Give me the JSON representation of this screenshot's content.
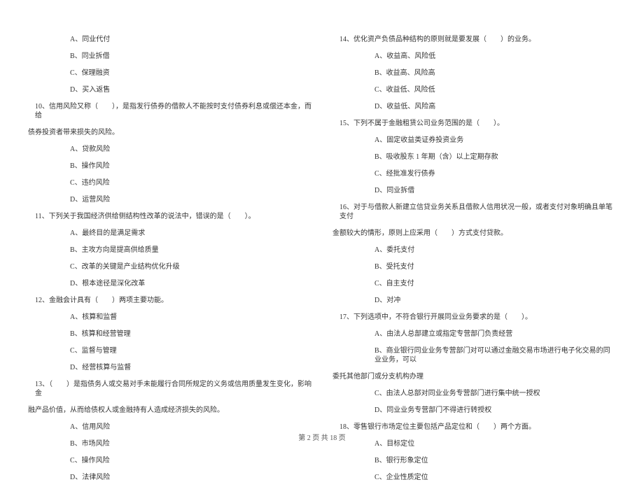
{
  "left_column": {
    "items": [
      {
        "type": "option",
        "text": "A、同业代付"
      },
      {
        "type": "option",
        "text": "B、同业拆借"
      },
      {
        "type": "option",
        "text": "C、保理融资"
      },
      {
        "type": "option",
        "text": "D、买入返售"
      },
      {
        "type": "question",
        "text": "10、信用风险又称（　　），是指发行债券的借款人不能按时支付债券利息或偿还本金，而给"
      },
      {
        "type": "question_cont",
        "text": "债券投资者带来损失的风险。"
      },
      {
        "type": "option",
        "text": "A、贷款风险"
      },
      {
        "type": "option",
        "text": "B、操作风险"
      },
      {
        "type": "option",
        "text": "C、违约风险"
      },
      {
        "type": "option",
        "text": "D、运营风险"
      },
      {
        "type": "question",
        "text": "11、下列关于我国经济供给侧结构性改革的说法中，错误的是（　　）。"
      },
      {
        "type": "option",
        "text": "A、最终目的是满足需求"
      },
      {
        "type": "option",
        "text": "B、主攻方向是提高供给质量"
      },
      {
        "type": "option",
        "text": "C、改革的关键是产业结构优化升级"
      },
      {
        "type": "option",
        "text": "D、根本途径是深化改革"
      },
      {
        "type": "question",
        "text": "12、金融会计具有（　　）两项主要功能。"
      },
      {
        "type": "option",
        "text": "A、核算和监督"
      },
      {
        "type": "option",
        "text": "B、核算和经营管理"
      },
      {
        "type": "option",
        "text": "C、监督与管理"
      },
      {
        "type": "option",
        "text": "D、经营核算与监督"
      },
      {
        "type": "question",
        "text": "13、（　　）是指债务人或交易对手未能履行合同所规定的义务或信用质量发生变化，影响金"
      },
      {
        "type": "question_cont",
        "text": "融产品价值，从而给债权人或金融持有人造成经济损失的风险。"
      },
      {
        "type": "option",
        "text": "A、信用风险"
      },
      {
        "type": "option",
        "text": "B、市场风险"
      },
      {
        "type": "option",
        "text": "C、操作风险"
      },
      {
        "type": "option",
        "text": "D、法律风险"
      }
    ]
  },
  "right_column": {
    "items": [
      {
        "type": "question",
        "text": "14、优化资产负债品种结构的原则就是要发展（　　）的业务。"
      },
      {
        "type": "option",
        "text": "A、收益高、风险低"
      },
      {
        "type": "option",
        "text": "B、收益高、风险高"
      },
      {
        "type": "option",
        "text": "C、收益低、风险低"
      },
      {
        "type": "option",
        "text": "D、收益低、风险高"
      },
      {
        "type": "question",
        "text": "15、下列不属于金融租赁公司业务范围的是（　　）。"
      },
      {
        "type": "option",
        "text": "A、固定收益类证券投资业务"
      },
      {
        "type": "option",
        "text": "B、吸收股东 1 年期（含）以上定期存款"
      },
      {
        "type": "option",
        "text": "C、经批准发行债券"
      },
      {
        "type": "option",
        "text": "D、同业拆借"
      },
      {
        "type": "question",
        "text": "16、对于与借款人新建立信贷业务关系且借款人信用状况一般，或者支付对象明确且单笔支付"
      },
      {
        "type": "question_cont",
        "text": "金额较大的情形，原则上应采用（　　）方式支付贷款。"
      },
      {
        "type": "option",
        "text": "A、委托支付"
      },
      {
        "type": "option",
        "text": "B、受托支付"
      },
      {
        "type": "option",
        "text": "C、自主支付"
      },
      {
        "type": "option",
        "text": "D、对冲"
      },
      {
        "type": "question",
        "text": "17、下列选项中，不符合银行开展同业业务要求的是（　　）。"
      },
      {
        "type": "option",
        "text": "A、由法人总部建立或指定专营部门负责经营"
      },
      {
        "type": "option",
        "text": "B、商业银行同业业务专营部门对可以通过金融交易市场进行电子化交易的同业业务，可以"
      },
      {
        "type": "question_cont",
        "text": "委托其他部门或分支机构办理"
      },
      {
        "type": "option",
        "text": "C、由法人总部对同业业务专营部门进行集中统一授权"
      },
      {
        "type": "option",
        "text": "D、同业业务专营部门不得进行转授权"
      },
      {
        "type": "question",
        "text": "18、零售银行市场定位主要包括产品定位和（　　）两个方面。"
      },
      {
        "type": "option",
        "text": "A、目标定位"
      },
      {
        "type": "option",
        "text": "B、银行形象定位"
      },
      {
        "type": "option",
        "text": "C、企业性质定位"
      }
    ]
  },
  "footer": {
    "text": "第 2 页 共 18 页"
  }
}
